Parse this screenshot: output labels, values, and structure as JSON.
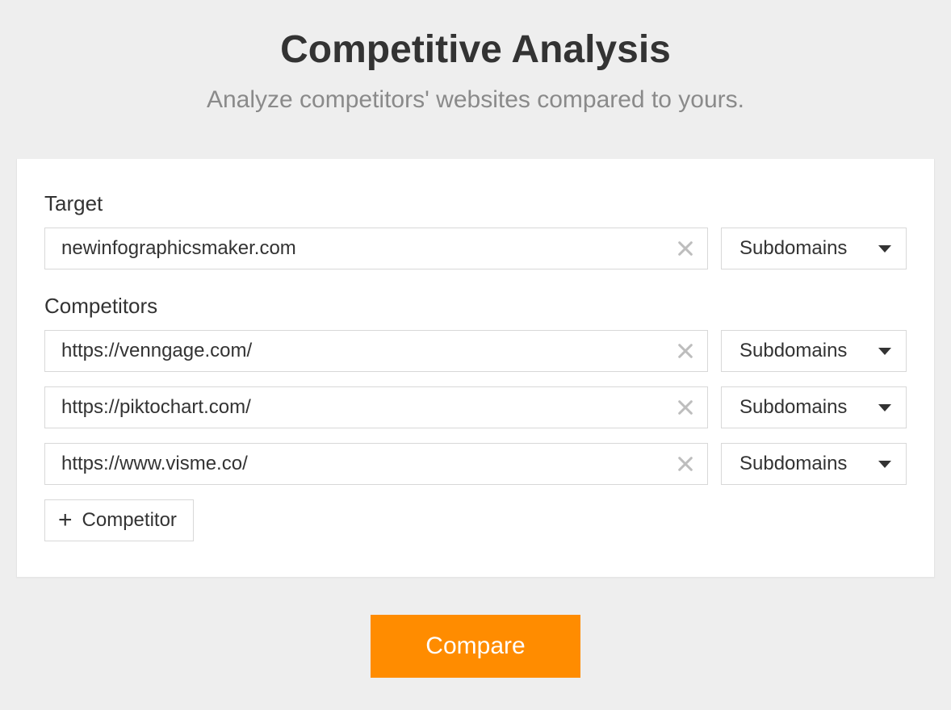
{
  "header": {
    "title": "Competitive Analysis",
    "subtitle": "Analyze competitors' websites compared to yours."
  },
  "target": {
    "label": "Target",
    "value": "newinfographicsmaker.com",
    "scope": "Subdomains"
  },
  "competitors": {
    "label": "Competitors",
    "items": [
      {
        "value": "https://venngage.com/",
        "scope": "Subdomains"
      },
      {
        "value": "https://piktochart.com/",
        "scope": "Subdomains"
      },
      {
        "value": "https://www.visme.co/",
        "scope": "Subdomains"
      }
    ],
    "add_label": "Competitor"
  },
  "actions": {
    "compare_label": "Compare"
  }
}
